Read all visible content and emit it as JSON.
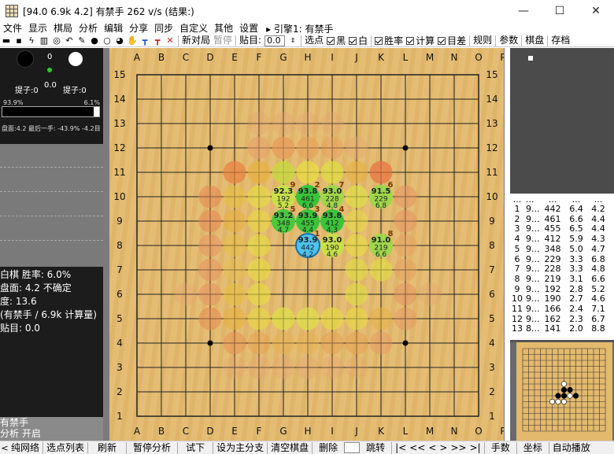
{
  "window": {
    "title": "[94.0 6.9k 4.2] 有禁手 262 v/s (结果:)",
    "minimize": "—",
    "maximize": "☐",
    "close": "✕"
  },
  "menu": [
    "文件",
    "显示",
    "棋局",
    "分析",
    "编辑",
    "分享",
    "同步",
    "自定义",
    "其他",
    "设置"
  ],
  "engine_label": "▸ 引擎1: 有禁手",
  "toolbar": {
    "new_game": "新对局",
    "pause": "暂停",
    "komi_label": "贴目:",
    "komi_value": "0.0",
    "select": "选点",
    "black": "黑",
    "white": "白",
    "winrate": "胜率",
    "calc": "计算",
    "target": "目差",
    "rules": "规则",
    "params": "参数",
    "board": "棋盘",
    "save": "存档"
  },
  "players": {
    "black_caps_label": "提子:0",
    "white_caps_label": "提子:0",
    "black_count": "0",
    "white_count": "0",
    "time": "0.0"
  },
  "winbar": {
    "black_pct": "93.9%",
    "white_pct": "6.1%",
    "white_fraction": 0.061,
    "summary": "盘面:4.2 最后一手: -43.9% -4.2目"
  },
  "info": {
    "line1": "白棋 胜率: 6.0%",
    "line2": "盘面: 4.2 不确定",
    "line3": "度: 13.6",
    "line4": "(有禁手 / 6.9k 计算量)",
    "line5": "贴目: 0.0"
  },
  "left_bottom": {
    "line1": "有禁手",
    "line2": "分析 开启"
  },
  "board": {
    "cols": [
      "A",
      "B",
      "C",
      "D",
      "E",
      "F",
      "G",
      "H",
      "I",
      "J",
      "K",
      "L",
      "M",
      "N",
      "O",
      "P"
    ],
    "rows": [
      "15",
      "14",
      "13",
      "12",
      "11",
      "10",
      "9",
      "8",
      "7",
      "6",
      "5",
      "4",
      "3",
      "2",
      "1"
    ]
  },
  "candidates": [
    {
      "order": "9",
      "wr": "92.3",
      "visits": "192",
      "score": "5.2",
      "col": 6,
      "row": 9,
      "color": "#c8e04a"
    },
    {
      "order": "2",
      "wr": "93.8",
      "visits": "461",
      "score": "6.6",
      "col": 7,
      "row": 9,
      "color": "#39c43a"
    },
    {
      "order": "7",
      "wr": "93.0",
      "visits": "228",
      "score": "4.8",
      "col": 8,
      "row": 9,
      "color": "#9fd64a"
    },
    {
      "order": "6",
      "wr": "91.5",
      "visits": "229",
      "score": "6.8",
      "col": 10,
      "row": 9,
      "color": "#9fd64a"
    },
    {
      "order": "5",
      "wr": "93.2",
      "visits": "348",
      "score": "4.7",
      "col": 6,
      "row": 8,
      "color": "#48c93e"
    },
    {
      "order": "3",
      "wr": "93.9",
      "visits": "455",
      "score": "4.4",
      "col": 7,
      "row": 8,
      "color": "#39c43a"
    },
    {
      "order": "4",
      "wr": "93.8",
      "visits": "412",
      "score": "4.3",
      "col": 8,
      "row": 8,
      "color": "#39c43a"
    },
    {
      "order": "1",
      "wr": "93.9",
      "visits": "442",
      "score": "4.2",
      "col": 7,
      "row": 7,
      "color": "#4cc3ef"
    },
    {
      "order": "",
      "wr": "93.0",
      "visits": "190",
      "score": "4.6",
      "col": 8,
      "row": 7,
      "color": "#c8e04a"
    },
    {
      "order": "8",
      "wr": "91.0",
      "visits": "219",
      "score": "6.6",
      "col": 10,
      "row": 7,
      "color": "#9fd64a"
    }
  ],
  "move_list": [
    [
      "1",
      "9...",
      "442",
      "6.4",
      "4.2"
    ],
    [
      "2",
      "9...",
      "461",
      "6.6",
      "4.4"
    ],
    [
      "3",
      "9...",
      "455",
      "6.5",
      "4.4"
    ],
    [
      "4",
      "9...",
      "412",
      "5.9",
      "4.3"
    ],
    [
      "5",
      "9...",
      "348",
      "5.0",
      "4.7"
    ],
    [
      "6",
      "9...",
      "229",
      "3.3",
      "6.8"
    ],
    [
      "7",
      "9...",
      "228",
      "3.3",
      "4.8"
    ],
    [
      "8",
      "9...",
      "219",
      "3.1",
      "6.6"
    ],
    [
      "9",
      "9...",
      "192",
      "2.8",
      "5.2"
    ],
    [
      "10",
      "9...",
      "190",
      "2.7",
      "4.6"
    ],
    [
      "11",
      "9...",
      "166",
      "2.4",
      "7.1"
    ],
    [
      "12",
      "9...",
      "162",
      "2.3",
      "6.7"
    ],
    [
      "13",
      "8...",
      "141",
      "2.0",
      "8.8"
    ]
  ],
  "move_list_header": "...",
  "bottombar": [
    "纯网络",
    "选点列表",
    "刷新",
    "暂停分析",
    "试下",
    "设为主分支",
    "清空棋盘",
    "删除",
    "跳转",
    "|<",
    "<<",
    "<",
    ">",
    ">>",
    ">|",
    "手数",
    "坐标",
    "自动播放"
  ],
  "colors": {
    "accent": "#39c43a",
    "best": "#4cc3ef",
    "board": "#e3b96d"
  }
}
